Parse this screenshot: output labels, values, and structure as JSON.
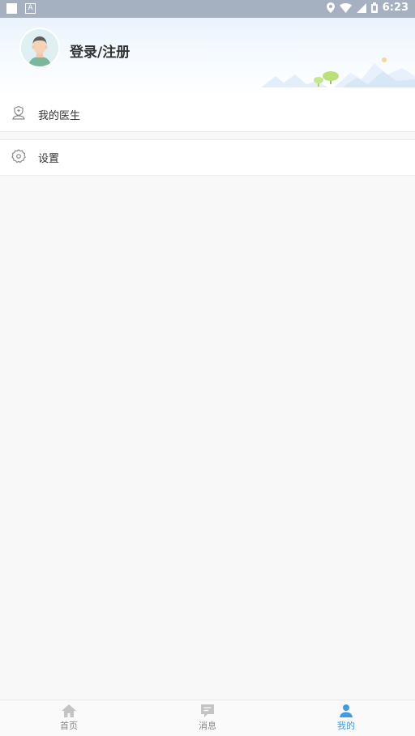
{
  "status_bar": {
    "time": "6:23"
  },
  "header": {
    "login_label": "登录/注册"
  },
  "menu": [
    {
      "label": "我的医生",
      "icon": "doctor-shield-icon"
    },
    {
      "label": "设置",
      "icon": "gear-icon"
    }
  ],
  "tabs": [
    {
      "label": "首页",
      "icon": "home-icon",
      "active": false
    },
    {
      "label": "消息",
      "icon": "message-icon",
      "active": false
    },
    {
      "label": "我的",
      "icon": "person-icon",
      "active": true
    }
  ],
  "colors": {
    "accent": "#3d9be9",
    "inactive": "#888888",
    "status_bar": "#a5b1c0"
  }
}
